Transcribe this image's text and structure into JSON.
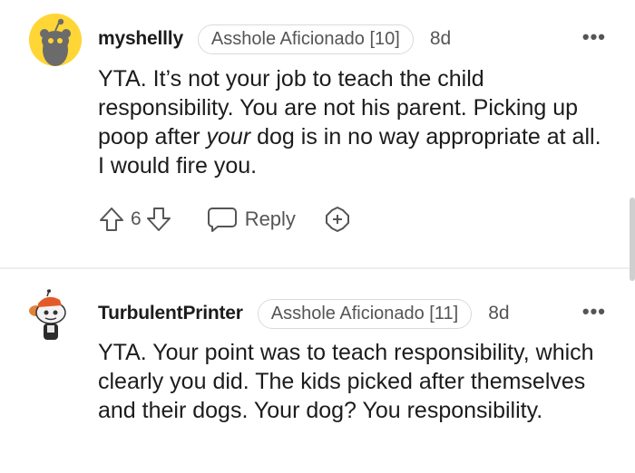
{
  "comments": [
    {
      "username": "myshellly",
      "flair": "Asshole Aficionado [10]",
      "age": "8d",
      "more": "•••",
      "body_pre": "YTA. It’s not your job to teach the child responsibility. You are not his parent. Picking up poop after ",
      "body_em": "your",
      "body_post": " dog is in no way appropriate at all. I would fire you.",
      "score": "6",
      "reply_label": "Reply"
    },
    {
      "username": "TurbulentPrinter",
      "flair": "Asshole Aficionado [11]",
      "age": "8d",
      "more": "•••",
      "body": "YTA. Your point was to teach responsibility, which clearly you did. The kids picked after themselves and their dogs. Your dog? You responsibility."
    }
  ],
  "icons": [
    "snoo-avatar-icon",
    "upvote-icon",
    "downvote-icon",
    "reply-bubble-icon",
    "award-icon",
    "more-options-icon"
  ],
  "colors": {
    "avatar_bg": "#ffd635",
    "text": "#1c1c1c",
    "muted": "#555555"
  }
}
